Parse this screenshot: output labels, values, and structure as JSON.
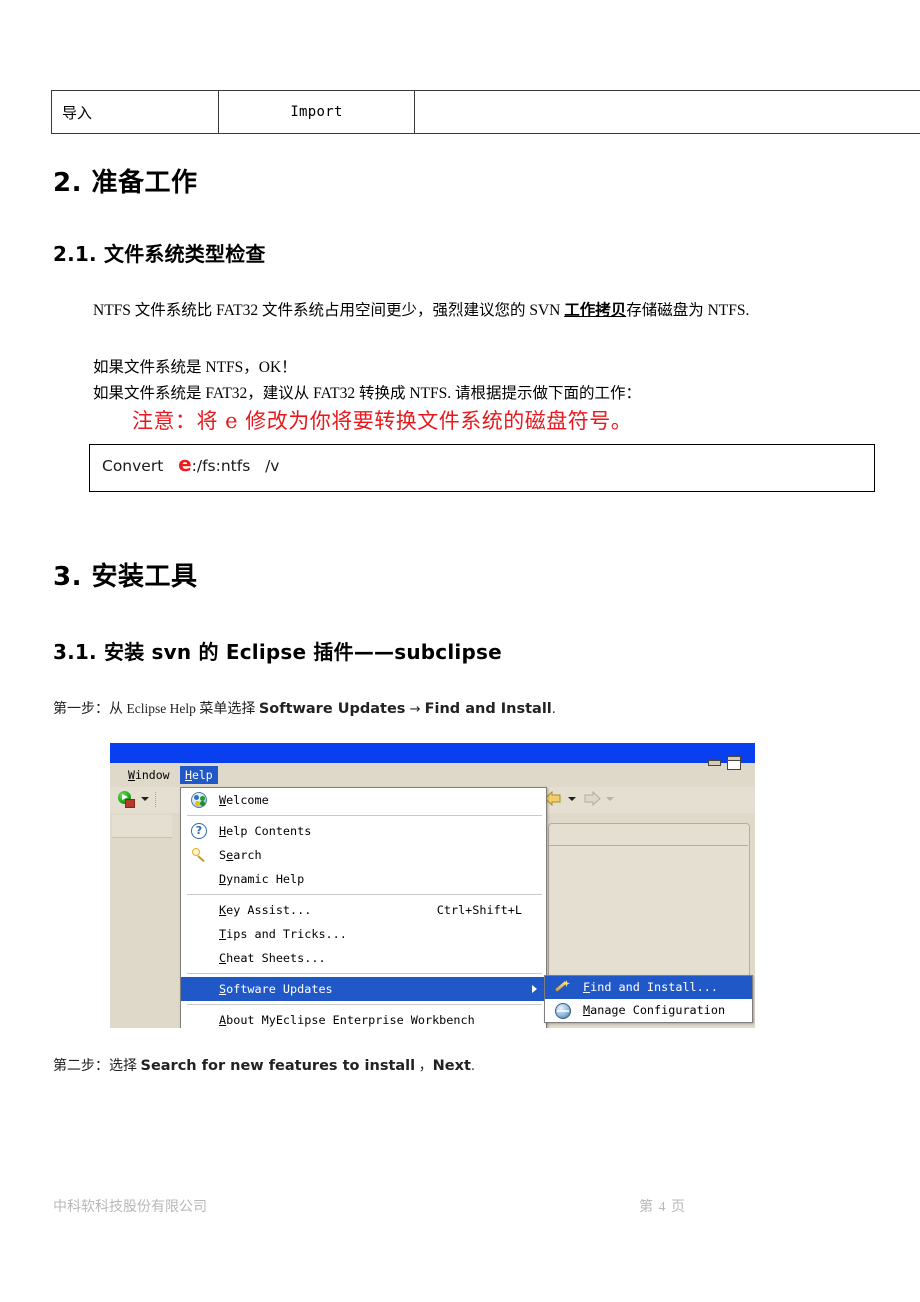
{
  "table": {
    "rows": [
      {
        "cn": "导入",
        "en": "Import",
        "extra": ""
      }
    ]
  },
  "headings": {
    "h1_preparation": "2. 准备工作",
    "h2_filesystem_check": "2.1. 文件系统类型检查",
    "h1_install_tools": "3. 安装工具",
    "h2_subclipse": "3.1. 安装 svn 的 Eclipse 插件——subclipse"
  },
  "body": {
    "ntfs_part1": "NTFS 文件系统比 FAT32 文件系统占用空间更少，强烈建议您的 SVN ",
    "ntfs_emph": "工作拷贝",
    "ntfs_part2": "存储磁盘为 NTFS.",
    "if_ntfs": "如果文件系统是 NTFS，OK！",
    "if_fat32": "如果文件系统是 FAT32，建议从 FAT32 转换成 NTFS. 请根据提示做下面的工作：",
    "warning": "注意：将 e 修改为你将要转换文件系统的磁盘符号。"
  },
  "convert": {
    "command_prefix": "Convert   ",
    "drive_letter": "e",
    "command_suffix": ":/fs:ntfs   /v"
  },
  "steps": {
    "step1_label": "第一步：从 ",
    "step1_menu": "Eclipse Help",
    "step1_mid": " 菜单选择 ",
    "step1_action_a": "Software Updates",
    "step1_arrow": " → ",
    "step1_action_b": "Find and Install",
    "step1_end": ".",
    "step2_label": "第二步：选择 ",
    "step2_action_a": "Search for new features to install",
    "step2_mid": " ，",
    "step2_action_b": "Next",
    "step2_end": "."
  },
  "eclipse": {
    "menubar": [
      {
        "label": "Window",
        "mnemonic_index": 0,
        "selected": false
      },
      {
        "label": "Help",
        "mnemonic_index": 0,
        "selected": true
      }
    ],
    "help_menu": [
      {
        "label": "Welcome",
        "icon": "welcome-globe-icon",
        "accel": "",
        "submenu": false,
        "selected": false
      },
      {
        "label": "Help Contents",
        "icon": "question-mark-icon",
        "accel": "",
        "submenu": false,
        "selected": false
      },
      {
        "label": "Search",
        "icon": "search-magnifier-icon",
        "accel": "",
        "submenu": false,
        "selected": false
      },
      {
        "label": "Dynamic Help",
        "icon": "",
        "accel": "",
        "submenu": false,
        "selected": false
      },
      {
        "label": "Key Assist...",
        "icon": "",
        "accel": "Ctrl+Shift+L",
        "submenu": false,
        "selected": false
      },
      {
        "label": "Tips and Tricks...",
        "icon": "",
        "accel": "",
        "submenu": false,
        "selected": false
      },
      {
        "label": "Cheat Sheets...",
        "icon": "",
        "accel": "",
        "submenu": false,
        "selected": false
      },
      {
        "label": "Software Updates",
        "icon": "",
        "accel": "",
        "submenu": true,
        "selected": true
      },
      {
        "label": "About MyEclipse Enterprise Workbench",
        "icon": "",
        "accel": "",
        "submenu": false,
        "selected": false
      }
    ],
    "software_updates_submenu": [
      {
        "label": "Find and Install...",
        "icon": "wand-icon",
        "selected": true
      },
      {
        "label": "Manage Configuration",
        "icon": "manage-globe-icon",
        "selected": false
      }
    ],
    "toolbar": {
      "run_icon": "run-with-lock-icon",
      "back_icon": "back-arrow-icon",
      "forward_icon": "forward-arrow-icon"
    },
    "view_controls": {
      "minimize_icon": "minimize-icon",
      "maximize_icon": "maximize-icon"
    },
    "colors": {
      "titlebar": "#0a3ff0",
      "chrome": "#ded9c8",
      "selection": "#2158c8"
    }
  },
  "footer": {
    "company": "中科软科技股份有限公司",
    "page": "第 4 页"
  }
}
